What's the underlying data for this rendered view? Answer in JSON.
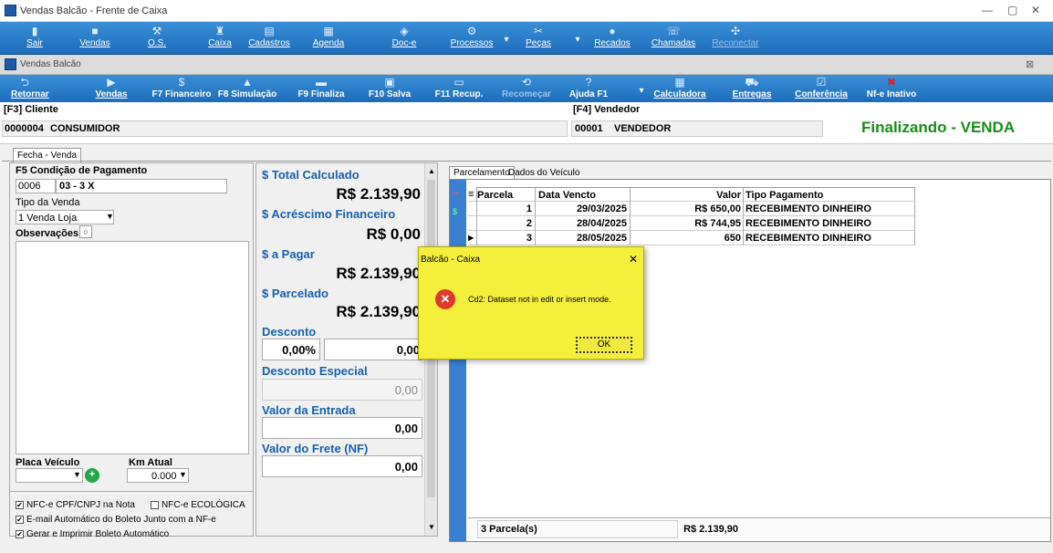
{
  "window": {
    "title": "Vendas Balcão - Frente de Caixa",
    "minimize": "—",
    "restore": "▢",
    "close": "✕"
  },
  "toolbar1": [
    {
      "label": "Sair",
      "icon": "▮"
    },
    {
      "label": "Vendas",
      "icon": "■"
    },
    {
      "label": "O.S.",
      "icon": "⚒"
    },
    {
      "label": "Caixa",
      "icon": "♜"
    },
    {
      "label": "Cadastros",
      "icon": "▤"
    },
    {
      "label": "Agenda",
      "icon": "▦"
    },
    {
      "label": "Doc-e",
      "icon": "◈"
    },
    {
      "label": "Processos",
      "icon": "⚙"
    },
    {
      "label": "Peças",
      "icon": "✂"
    },
    {
      "label": "Recados",
      "icon": "●"
    },
    {
      "label": "Chamadas",
      "icon": "☏"
    },
    {
      "label": "Reconectar",
      "icon": "✣"
    }
  ],
  "subwindow": {
    "title": "Vendas Balcão",
    "close": "⊠"
  },
  "toolbar2": [
    {
      "label": "Retornar",
      "icon": "⮌"
    },
    {
      "label": "Vendas",
      "icon": "▶"
    },
    {
      "label": "F7 Financeiro",
      "icon": "$"
    },
    {
      "label": "F8 Simulação",
      "icon": "▲"
    },
    {
      "label": "F9 Finaliza",
      "icon": "▬"
    },
    {
      "label": "F10 Salva",
      "icon": "▣"
    },
    {
      "label": "F11 Recup.",
      "icon": "▭"
    },
    {
      "label": "Recomeçar",
      "icon": "⟲"
    },
    {
      "label": "Ajuda F1",
      "icon": "?"
    },
    {
      "label": "Calculadora",
      "icon": "▦"
    },
    {
      "label": "Entregas",
      "icon": "⛟"
    },
    {
      "label": "Conferência",
      "icon": "☑"
    },
    {
      "label": "Nf-e Inativo",
      "icon": "✖"
    }
  ],
  "header": {
    "cliente_label": "[F3] Cliente",
    "cliente_code": "0000004",
    "cliente_name": "CONSUMIDOR",
    "vendedor_label": "[F4] Vendedor",
    "vendedor_code": "00001",
    "vendedor_name": "VENDEDOR",
    "status": "Finalizando - VENDA"
  },
  "main_tab": "Fecha - Venda",
  "left": {
    "cond_label": "F5 Condição de Pagamento",
    "cond_code": "0006",
    "cond_value": "03 - 3 X",
    "tipo_label": "Tipo da Venda",
    "tipo_value": "1 Venda Loja",
    "obs_label": "Observações",
    "placa_label": "Placa Veículo",
    "km_label": "Km Atual",
    "km_value": "0.000",
    "checks": [
      {
        "label": "NFC-e CPF/CNPJ na Nota",
        "checked": true
      },
      {
        "label": "NFC-e ECOLÓGICA",
        "checked": false
      },
      {
        "label": "E-mail Automático do Boleto Junto com a NF-e",
        "checked": true
      },
      {
        "label": "Gerar e Imprimir Boleto Automático",
        "checked": true
      }
    ]
  },
  "mid": {
    "total_label": "$ Total Calculado",
    "total_value": "R$ 2.139,90",
    "acresc_label": "$ Acréscimo Financeiro",
    "acresc_value": "R$ 0,00",
    "pagar_label": "$ a Pagar",
    "pagar_value": "R$ 2.139,90",
    "parcelado_label": "$ Parcelado",
    "parcelado_value": "R$ 2.139,90",
    "desconto_label": "Desconto",
    "desconto_pct": "0,00%",
    "desconto_val": "0,00",
    "desc_esp_label": "Desconto Especial",
    "desc_esp_value": "0,00",
    "entrada_label": "Valor da Entrada",
    "entrada_value": "0,00",
    "frete_label": "Valor do Frete (NF)",
    "frete_value": "0,00"
  },
  "right_tabs": [
    "Parcelamento",
    "Dados do Veículo"
  ],
  "grid": {
    "headers": [
      "Parcela",
      "Data Vencto",
      "Valor",
      "Tipo Pagamento"
    ],
    "rows": [
      [
        "1",
        "29/03/2025",
        "R$ 650,00",
        "RECEBIMENTO DINHEIRO"
      ],
      [
        "2",
        "28/04/2025",
        "R$ 744,95",
        "RECEBIMENTO DINHEIRO"
      ],
      [
        "3",
        "28/05/2025",
        "650",
        "RECEBIMENTO DINHEIRO"
      ]
    ],
    "footer_count": "3 Parcela(s)",
    "footer_total": "R$ 2.139,90"
  },
  "dialog": {
    "title": "Balcão - Caixa",
    "message": "Cd2: Dataset not in edit or insert mode.",
    "ok": "OK",
    "close": "✕"
  }
}
